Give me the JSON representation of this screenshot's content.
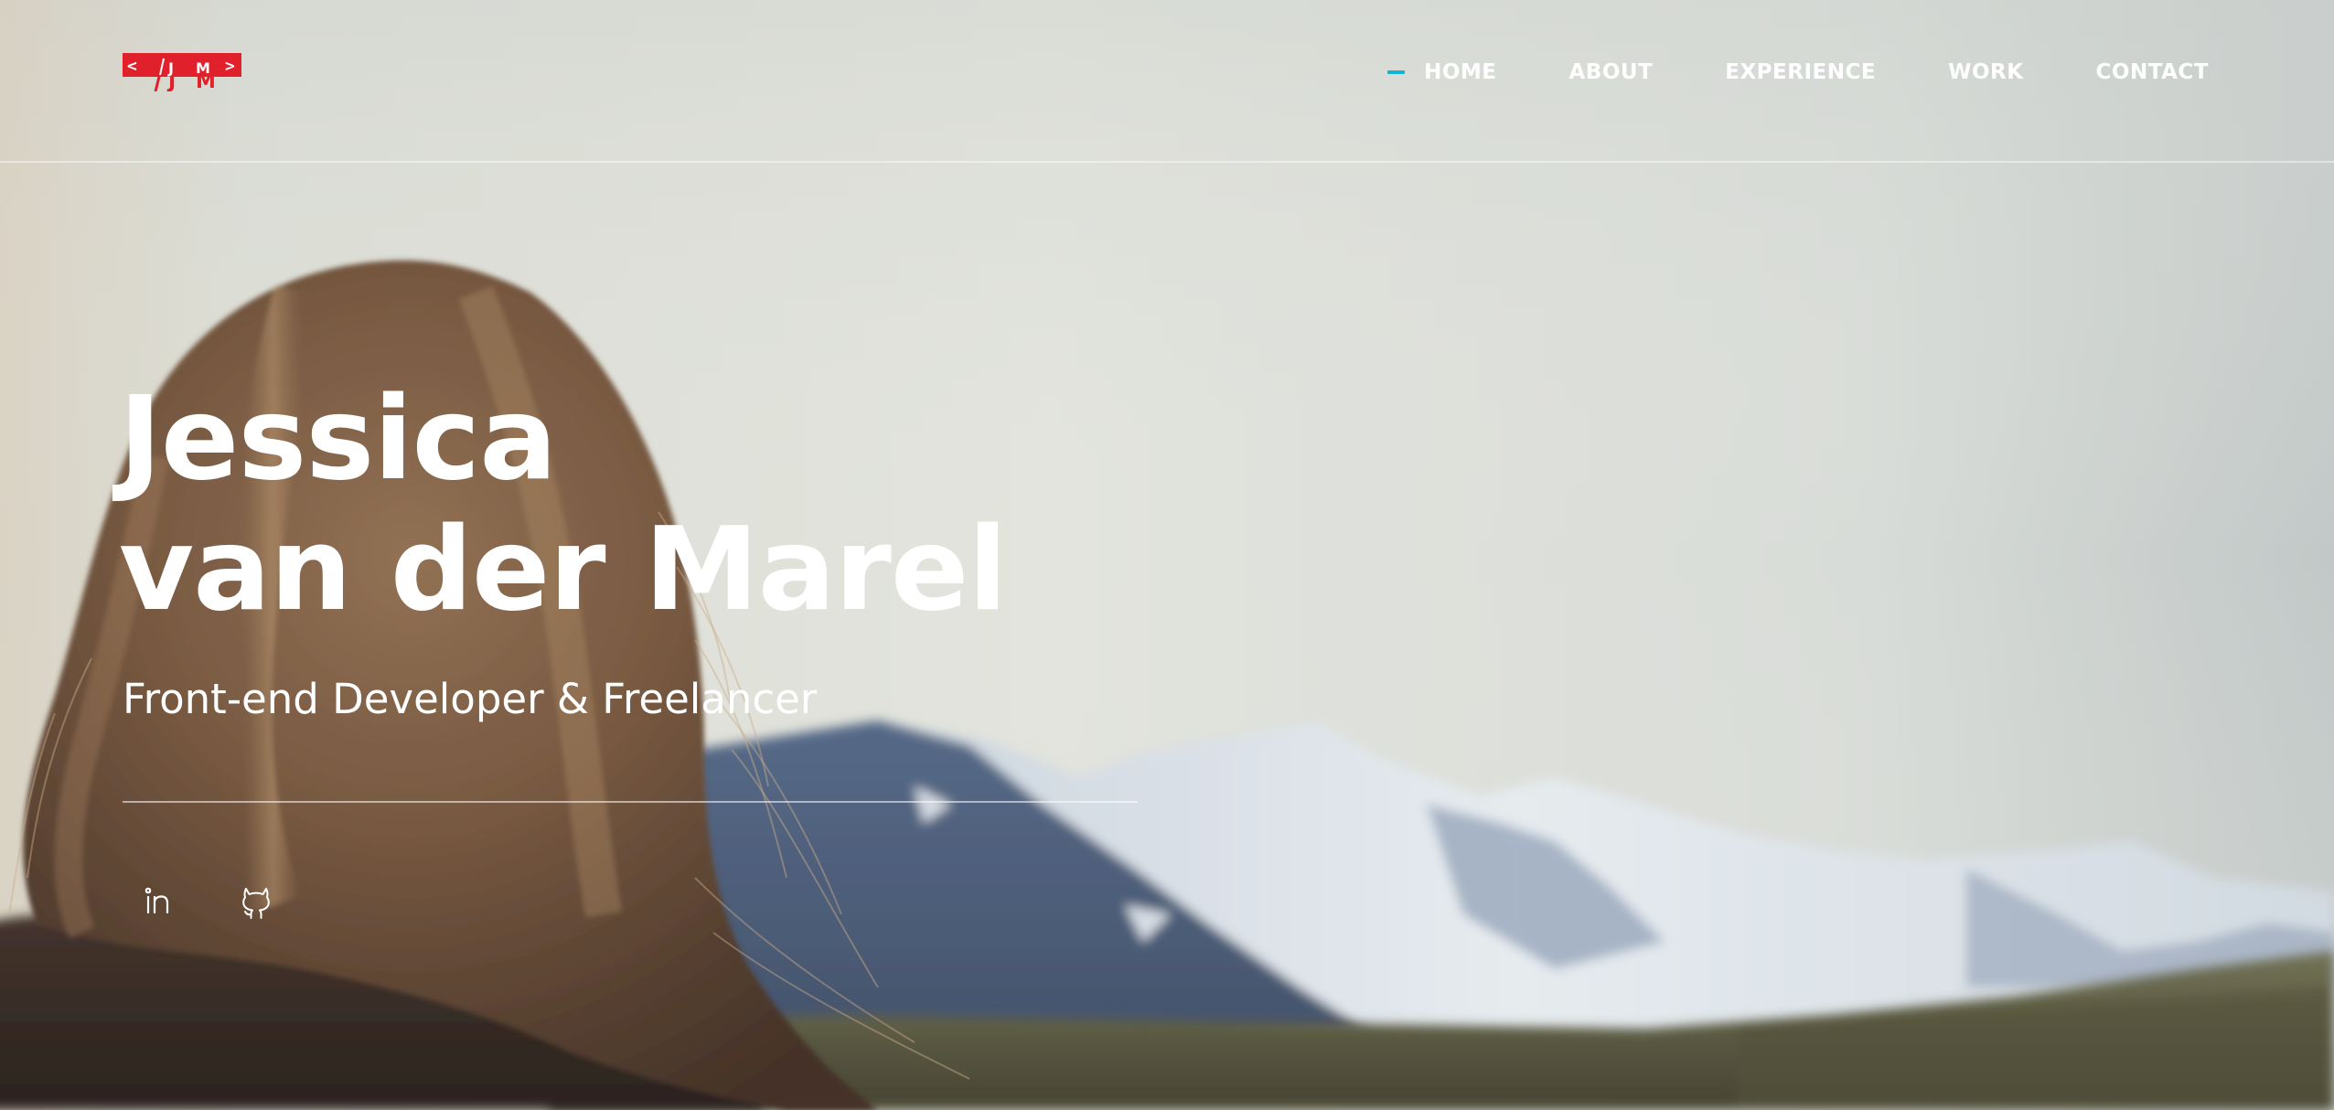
{
  "brand": {
    "logo_text": "</JM>",
    "logo_color": "#e0202b"
  },
  "nav": {
    "items": [
      {
        "label": "HOME",
        "active": true
      },
      {
        "label": "ABOUT",
        "active": false
      },
      {
        "label": "EXPERIENCE",
        "active": false
      },
      {
        "label": "WORK",
        "active": false
      },
      {
        "label": "CONTACT",
        "active": false
      }
    ],
    "active_indicator_color": "#14b4d8"
  },
  "hero": {
    "name_line1": "Jessica",
    "name_line2": "van der Marel",
    "subtitle": "Front-end Developer & Freelancer"
  },
  "social": [
    {
      "icon": "linkedin-icon"
    },
    {
      "icon": "github-icon"
    }
  ]
}
